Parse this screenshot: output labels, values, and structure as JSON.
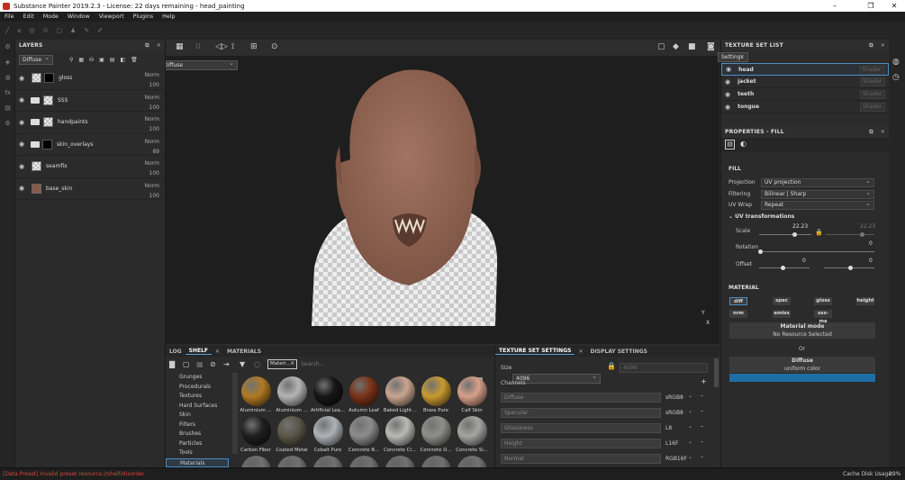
{
  "window": {
    "title": "Substance Painter 2019.2.3 - License: 22 days remaining - head_painting"
  },
  "menu": [
    "File",
    "Edit",
    "Mode",
    "Window",
    "Viewport",
    "Plugins",
    "Help"
  ],
  "layers": {
    "title": "LAYERS",
    "channel": "Diffuse",
    "items": [
      {
        "name": "gloss",
        "blend": "Norm",
        "opacity": "100"
      },
      {
        "name": "SSS",
        "blend": "Norm",
        "opacity": "100"
      },
      {
        "name": "handpaints",
        "blend": "Norm",
        "opacity": "100"
      },
      {
        "name": "skin_overlays",
        "blend": "Norm",
        "opacity": "89"
      },
      {
        "name": "seamfix",
        "blend": "Norm",
        "opacity": "100"
      },
      {
        "name": "base_skin",
        "blend": "Norm",
        "opacity": "100"
      }
    ]
  },
  "viewport": {
    "channel": "Diffuse",
    "axis_y": "Y",
    "axis_x": "X"
  },
  "shelf": {
    "tabs": [
      "LOG",
      "SHELF",
      "MATERIALS"
    ],
    "filter_chip": "Materi...",
    "search_placeholder": "Search...",
    "categories": [
      "Grunges",
      "Procedurals",
      "Textures",
      "Hard Surfaces",
      "Skin",
      "Filters",
      "Brushes",
      "Particles",
      "Tools",
      "Materials"
    ],
    "materials": [
      {
        "label": "Aluminium ...",
        "color": "#b07a22"
      },
      {
        "label": "Aluminium ...",
        "color": "#b5b5b5"
      },
      {
        "label": "Artificial Lea...",
        "color": "#161616"
      },
      {
        "label": "Autumn Leaf",
        "color": "#7a3218"
      },
      {
        "label": "Baked Light...",
        "color": "#c9a58f"
      },
      {
        "label": "Brass Pure",
        "color": "#c89a30"
      },
      {
        "label": "Calf Skin",
        "color": "#d7a08a"
      },
      {
        "label": "Carbon Fiber",
        "color": "#1f1f1f"
      },
      {
        "label": "Coated Metal",
        "color": "#5b5647"
      },
      {
        "label": "Cobalt Pure",
        "color": "#aeb3b8"
      },
      {
        "label": "Concrete B...",
        "color": "#8c8c8c"
      },
      {
        "label": "Concrete Cl...",
        "color": "#b9b9b6"
      },
      {
        "label": "Concrete D...",
        "color": "#8f8f8a"
      },
      {
        "label": "Concrete Si...",
        "color": "#a5a5a2"
      }
    ]
  },
  "tss": {
    "tabs": [
      "TEXTURE SET SETTINGS",
      "DISPLAY SETTINGS"
    ],
    "size_label": "Size",
    "size_value": "4096",
    "size_locked_value": "4096",
    "channels_label": "Channels",
    "channels": [
      {
        "name": "Diffuse",
        "format": "sRGB8"
      },
      {
        "name": "Specular",
        "format": "sRGB8"
      },
      {
        "name": "Glossiness",
        "format": "L8"
      },
      {
        "name": "Height",
        "format": "L16F"
      },
      {
        "name": "Normal",
        "format": "RGB16F"
      }
    ]
  },
  "texture_sets": {
    "title": "TEXTURE SET LIST",
    "settings": "Settings",
    "items": [
      {
        "name": "head",
        "shader": "Shader"
      },
      {
        "name": "jacket",
        "shader": "Shader"
      },
      {
        "name": "teeth",
        "shader": "Shader"
      },
      {
        "name": "tongue",
        "shader": "Shader"
      }
    ]
  },
  "properties": {
    "title": "PROPERTIES - FILL",
    "fill_label": "FILL",
    "projection_label": "Projection",
    "projection_value": "UV projection",
    "filtering_label": "Filtering",
    "filtering_value": "Bilinear | Sharp",
    "uvwrap_label": "UV Wrap",
    "uvwrap_value": "Repeat",
    "uvt_label": "UV transformations",
    "scale_label": "Scale",
    "scale_value": "22.23",
    "scale_value2": "22.23",
    "rotation_label": "Rotation",
    "rotation_value": "0",
    "offset_label": "Offset",
    "offset_x": "0",
    "offset_y": "0",
    "material_label": "MATERIAL",
    "chips": [
      "diff",
      "spec",
      "gloss",
      "height",
      "nrm",
      "emiss",
      "sss-ma"
    ],
    "material_mode_label": "Material mode",
    "no_resource": "No Resource Selected",
    "or_label": "Or",
    "diffuse_label": "Diffuse",
    "uniform_label": "uniform color",
    "diffuse_color": "#1e6ea6"
  },
  "status": {
    "error": "[Data Preset] Invalid preset resource://shelf/disorder",
    "cache_label": "Cache Disk Usage:",
    "cache_value": "29%"
  }
}
